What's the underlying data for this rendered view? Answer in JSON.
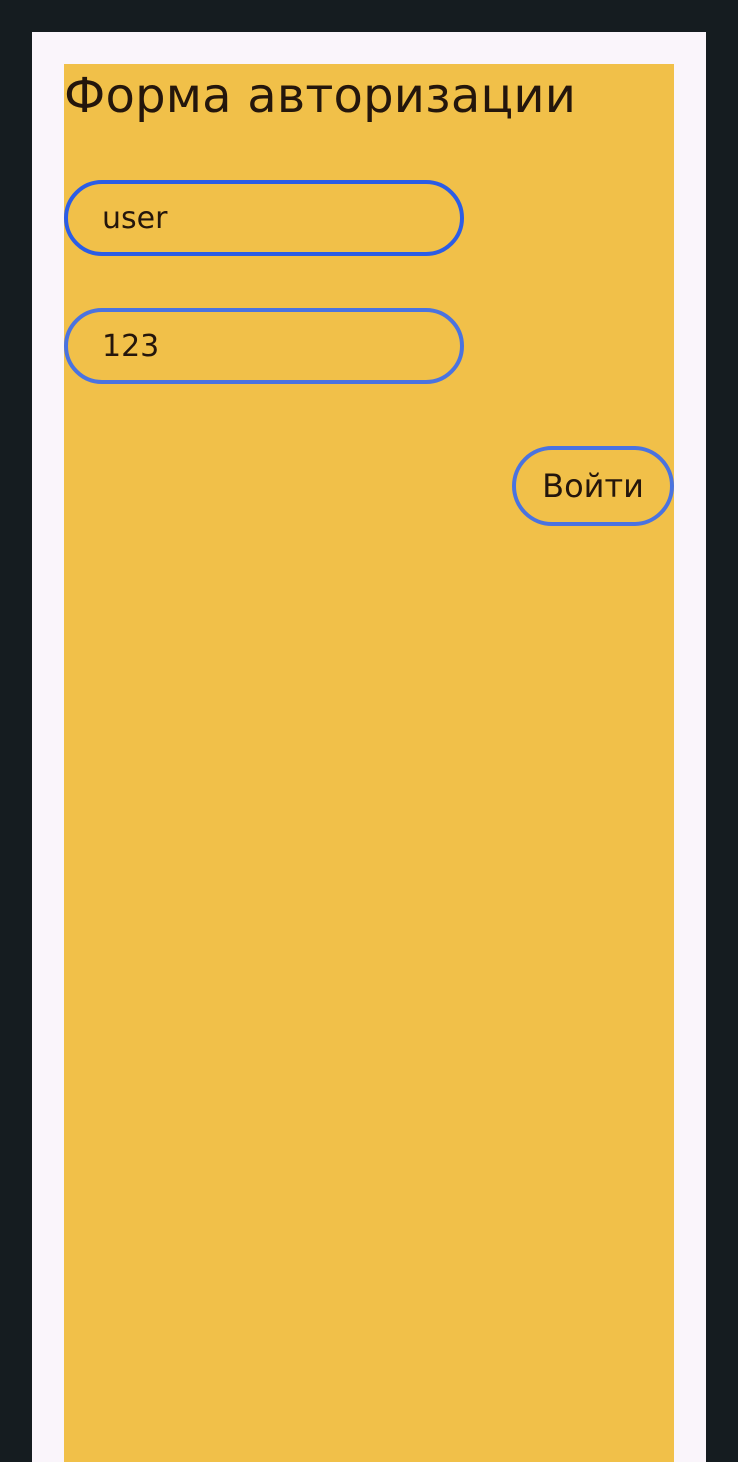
{
  "form": {
    "title": "Форма авторизации",
    "username": {
      "value": "user"
    },
    "password": {
      "value": "123"
    },
    "submit_label": "Войти"
  },
  "colors": {
    "background": "#151c20",
    "frame": "#faf5fb",
    "panel": "#f1c049",
    "focused_border": "#2b5de6",
    "border": "#4a73e0",
    "text": "#24160c"
  }
}
